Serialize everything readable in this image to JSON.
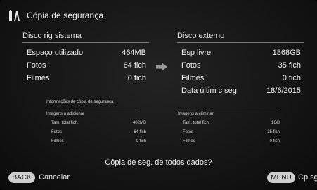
{
  "header": {
    "title": "Cópia de segurança",
    "icon": "backup-icon"
  },
  "left_column": {
    "heading": "Disco rig sistema",
    "rows": [
      {
        "label": "Espaço utilizado",
        "value": "464MB"
      },
      {
        "label": "Fotos",
        "value": "64 fich"
      },
      {
        "label": "Filmes",
        "value": "0 fich"
      }
    ]
  },
  "right_column": {
    "heading": "Disco externo",
    "rows": [
      {
        "label": "Esp livre",
        "value": "1868GB"
      },
      {
        "label": "Fotos",
        "value": "35 fich"
      },
      {
        "label": "Filmes",
        "value": "0 fich"
      },
      {
        "label": "Data últim c seg",
        "value": "18/6/2015"
      }
    ]
  },
  "info": {
    "title": "Informações de cópia de segurança",
    "add": {
      "heading": "Imagens a adicionar",
      "rows": [
        {
          "label": "Tam. total fich.",
          "value": "402MB"
        },
        {
          "label": "Fotos",
          "value": "64 fich"
        },
        {
          "label": "Filmes",
          "value": "0 fich"
        }
      ]
    },
    "remove": {
      "heading": "Imagens a eliminar",
      "rows": [
        {
          "label": "Tam. total fich.",
          "value": "1GB"
        },
        {
          "label": "Fotos",
          "value": "35 fich"
        },
        {
          "label": "Filmes",
          "value": "0 fich"
        }
      ]
    }
  },
  "question": "Cópia de seg. de todos dados?",
  "footer": {
    "back_key": "BACK",
    "back_label": "Cancelar",
    "menu_key": "MENU",
    "menu_label": "Cp sg"
  },
  "colors": {
    "pill_bg": "#cfcfcf",
    "background": "#151515",
    "divider": "#7a7a7a"
  }
}
